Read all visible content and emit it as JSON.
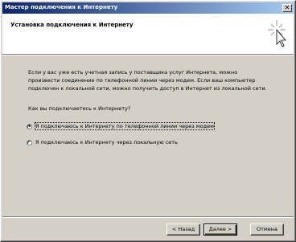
{
  "window": {
    "title": "Мастер подключения к Интернету",
    "close_glyph": "✕"
  },
  "header": {
    "title": "Установка подключения к Интернету",
    "icon": "wizard-sparkle-icon"
  },
  "content": {
    "description_line1": "Если у вас уже есть учетная запись у поставщика услуг Интернета, можно",
    "description_line2": "произвести соединение по телефонной линии через модем. Если ваш компьютер",
    "description_line3": "подключен к локальной сети, можно получить доступ в Интернет из локальной сети.",
    "question": "Как вы подключаетесь к Интернету?",
    "options": [
      {
        "label": "Я подключаюсь к Интернету по телефонной линии через модем",
        "selected": true
      },
      {
        "label": "Я подключаюсь к Интернету через локальную сеть",
        "selected": false
      }
    ]
  },
  "buttons": {
    "back": "< Назад",
    "next": "Далее >",
    "cancel": "Отмена"
  },
  "colors": {
    "title_gradient_start": "#0a246a",
    "title_gradient_end": "#a6caf0",
    "face": "#d4d0c8"
  }
}
